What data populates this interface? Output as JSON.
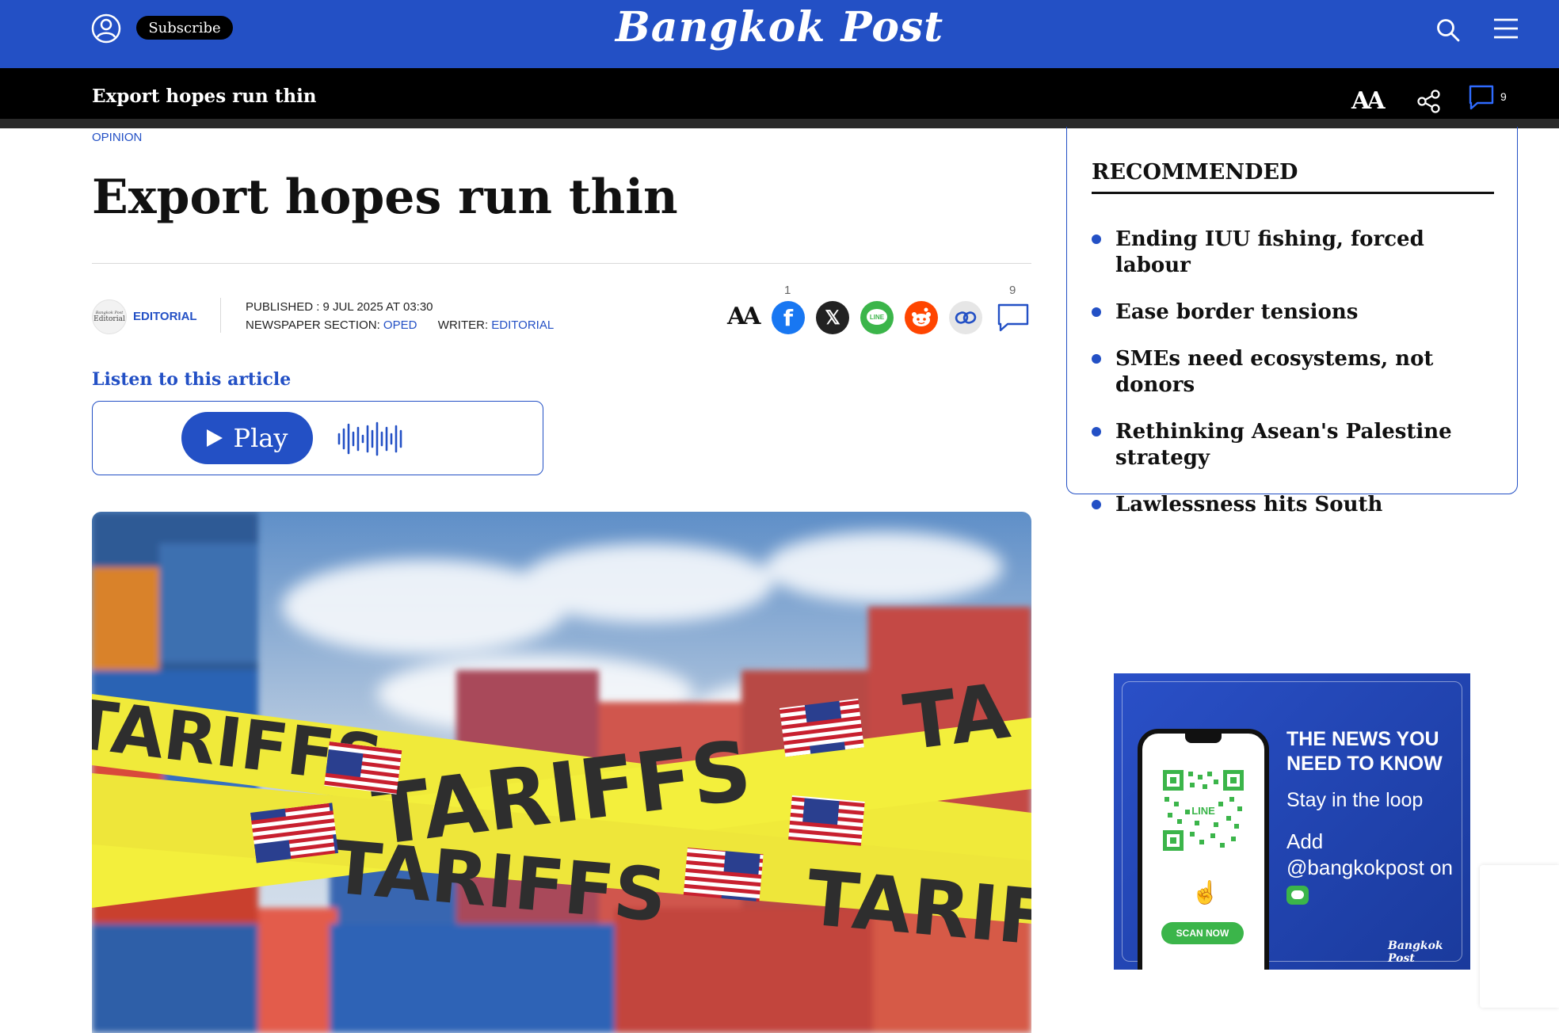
{
  "header": {
    "brand": "Bangkok Post",
    "subscribe_label": "Subscribe",
    "icons": [
      "user-icon",
      "search-icon",
      "menu-icon"
    ],
    "accent_color": "#2350c5"
  },
  "sticky_bar": {
    "title": "Export hopes run thin",
    "font_size_label": "AA",
    "comment_count": "9",
    "icons": [
      "font-size-icon",
      "share-icon",
      "comment-icon"
    ]
  },
  "article": {
    "section": "OPINION",
    "headline": "Export hopes run thin",
    "author_logo_top": "Bangkok Post",
    "author_logo_bottom": "Editorial",
    "author": "EDITORIAL",
    "published": "PUBLISHED : 9 JUL 2025 AT 03:30",
    "newspaper_section_label": "NEWSPAPER SECTION:",
    "newspaper_section_value": "OPED",
    "writer_label": "WRITER:",
    "writer_value": "EDITORIAL",
    "share": {
      "font_size_label": "AA",
      "facebook_count": "1",
      "comment_count": "9",
      "facebook_glyph": "f",
      "x_glyph": "𝕏",
      "line_glyph": "LINE",
      "icons": [
        "font-size-icon",
        "facebook-icon",
        "x-icon",
        "line-icon",
        "reddit-icon",
        "copy-link-icon",
        "comment-icon"
      ]
    },
    "listen": {
      "label": "Listen to this article",
      "play_label": "Play"
    },
    "hero_image": {
      "tape_text": "TARIFFS",
      "tape_text_edge": "TA"
    }
  },
  "sidebar": {
    "recommended_title": "RECOMMENDED",
    "items": [
      "Ending IUU fishing, forced labour",
      "Ease border tensions",
      "SMEs need ecosystems, not donors",
      "Rethinking Asean's Palestine strategy",
      "Lawlessness hits South"
    ],
    "ad": {
      "headline": "THE NEWS YOU NEED TO KNOW",
      "sub": "Stay in the loop",
      "cta": "Add @bangkokpost on",
      "qr_label": "LINE",
      "scan_label": "SCAN NOW",
      "brand": "Bangkok Post",
      "line_color": "#3bb54a"
    }
  }
}
